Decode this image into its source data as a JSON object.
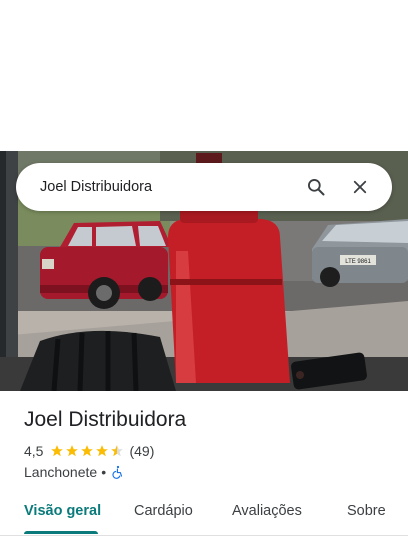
{
  "search": {
    "query": "Joel Distribuidora",
    "search_icon": "search-icon",
    "close_icon": "close-icon"
  },
  "photo": {
    "car_plate": "LTE 9861"
  },
  "place": {
    "name": "Joel Distribuidora",
    "rating": "4,5",
    "stars": 4.5,
    "review_count": "(49)",
    "category": "Lanchonete",
    "separator": "•",
    "accessibility_icon": "wheelchair-icon"
  },
  "tabs": [
    {
      "label": "Visão geral",
      "active": true
    },
    {
      "label": "Cardápio",
      "active": false
    },
    {
      "label": "Avaliações",
      "active": false
    },
    {
      "label": "Sobre",
      "active": false
    }
  ],
  "colors": {
    "accent": "#0b7a7a",
    "star": "#fbbc04",
    "star_empty": "#dadce0",
    "accessibility": "#1a73e8"
  }
}
